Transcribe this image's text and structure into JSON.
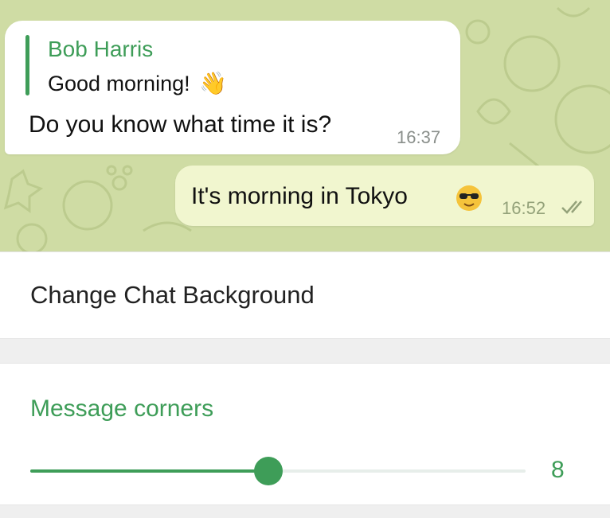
{
  "chat_preview": {
    "incoming": {
      "reply_name": "Bob Harris",
      "reply_text": "Good morning!",
      "reply_emoji": "👋",
      "text": "Do you know what time it is?",
      "time": "16:37"
    },
    "outgoing": {
      "text": "It's morning in Tokyo",
      "emoji": "sunglasses-face-icon",
      "time": "16:52",
      "status": "read"
    }
  },
  "settings": {
    "change_background_label": "Change Chat Background",
    "message_corners_title": "Message corners",
    "message_corners_value": "8",
    "message_corners_fraction": 0.48
  },
  "colors": {
    "accent": "#3e9d58",
    "chat_bg": "#cfdca4",
    "outgoing_bubble": "#f1f6cf"
  }
}
